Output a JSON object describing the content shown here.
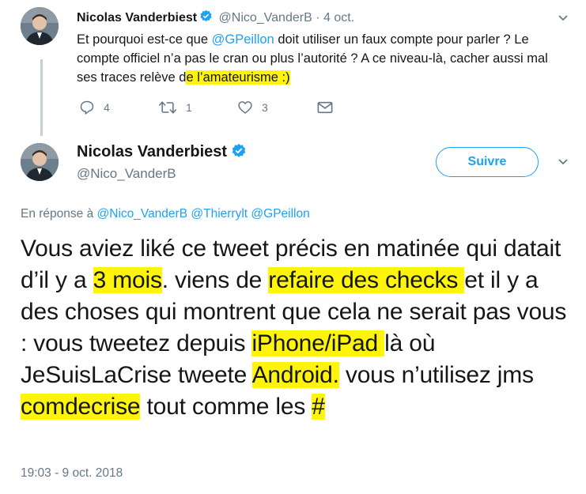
{
  "reply": {
    "name": "Nicolas Vanderbiest",
    "handle": "@Nico_VanderB",
    "separator": "·",
    "date": "4 oct.",
    "text_1": "Et pourquoi est-ce que ",
    "mention": "@GPeillon",
    "text_2": " doit utiliser un faux compte pour parler ? Le compte officiel n’a pas le cran ou plus l’autorité ? A ce niveau-là, cacher aussi mal ses traces relève d",
    "text_hl": "e l’amateurisme :)",
    "reply_count": "4",
    "retweet_count": "1",
    "like_count": "3"
  },
  "main": {
    "name": "Nicolas Vanderbiest",
    "handle": "@Nico_VanderB",
    "follow_label": "Suivre",
    "in_reply_prefix": "En réponse à ",
    "in_reply_1": "@Nico_VanderB",
    "in_reply_2": "@Thierrylt",
    "in_reply_3": "@GPeillon",
    "t1": "Vous aviez liké ce tweet précis en matinée qui datait d’il y a ",
    "h1": "3 mois",
    "t2": ". viens de ",
    "h2": "refaire des checks ",
    "t3": "et il y a des choses qui montrent que cela ne serait pas vous : vous tweetez depuis ",
    "h3": "iPhone/iPad ",
    "t4": "là où JeSuisLaCrise tweete ",
    "h4": "Android.",
    "t5": " vous n’utilisez jms ",
    "h5": "comdecrise",
    "t6": " tout comme les ",
    "h6": "# ",
    "timestamp": "19:03 - 9 oct. 2018"
  },
  "colors": {
    "accent": "#1da1f2",
    "muted": "#657786",
    "highlight": "#fff40a"
  }
}
